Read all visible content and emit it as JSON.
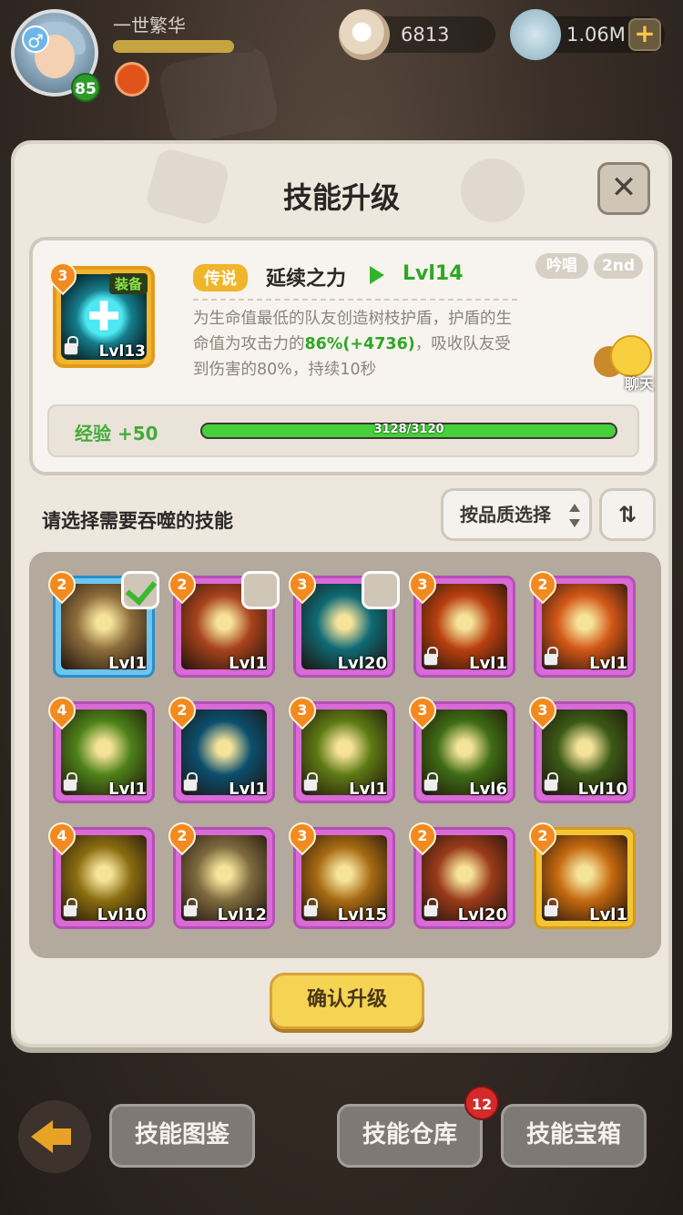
{
  "player": {
    "name": "一世繁华",
    "level": "85",
    "exp_fraction": 0.85
  },
  "currency": {
    "pearls": "6813",
    "shells": "1.06M"
  },
  "panel": {
    "title": "技能升级",
    "skill": {
      "rarity": "传说",
      "name": "延续之力",
      "level": "Lvl14",
      "icon_level": "Lvl13",
      "equip": "装备",
      "star": "3",
      "tag1": "吟唱",
      "tag2": "2nd",
      "desc_pre": "为生命值最低的队友创造树枝护盾，护盾的生命值为攻击力的",
      "desc_pct": "86%",
      "desc_bonus": "(+4736)",
      "desc_post": "，吸收队友受到伤害的80%，持续10秒"
    },
    "exp": {
      "label": "经验 +50",
      "progress": "3128/3120",
      "fill_fraction": 1.0
    },
    "chat_label": "聊天",
    "choose_label": "请选择需要吞噬的技能",
    "filter_label": "按品质选择",
    "confirm_label": "确认升级"
  },
  "grid": [
    {
      "star": "2",
      "level": "Lvl1",
      "quality": "blue",
      "check": "on",
      "lock": false,
      "art": "owl-art",
      "color": "#8d6d3c"
    },
    {
      "star": "2",
      "level": "Lvl1",
      "quality": "purple",
      "check": "off",
      "lock": false,
      "art": "spiral-art",
      "color": "#a8431d"
    },
    {
      "star": "3",
      "level": "Lvl20",
      "quality": "purple",
      "check": "off",
      "lock": false,
      "art": "heal-art",
      "color": "#0e6a74"
    },
    {
      "star": "3",
      "level": "Lvl1",
      "quality": "purple",
      "check": "",
      "lock": true,
      "art": "flame-art",
      "color": "#b9400f"
    },
    {
      "star": "2",
      "level": "Lvl1",
      "quality": "purple",
      "check": "",
      "lock": true,
      "art": "cross-art",
      "color": "#d35717"
    },
    {
      "star": "4",
      "level": "Lvl1",
      "quality": "purple",
      "check": "",
      "lock": true,
      "art": "robot-art",
      "color": "#4d8218"
    },
    {
      "star": "2",
      "level": "Lvl1",
      "quality": "purple",
      "check": "",
      "lock": true,
      "art": "moon-art",
      "color": "#0b4f6e"
    },
    {
      "star": "3",
      "level": "Lvl1",
      "quality": "purple",
      "check": "",
      "lock": true,
      "art": "seed-art",
      "color": "#5e7a14"
    },
    {
      "star": "3",
      "level": "Lvl6",
      "quality": "purple",
      "check": "",
      "lock": true,
      "art": "green-heal-art",
      "color": "#3e6c14"
    },
    {
      "star": "3",
      "level": "Lvl10",
      "quality": "purple",
      "check": "",
      "lock": true,
      "art": "heart-art",
      "color": "#3b5a16"
    },
    {
      "star": "4",
      "level": "Lvl10",
      "quality": "purple",
      "check": "",
      "lock": true,
      "art": "shadow-art",
      "color": "#8a6d10"
    },
    {
      "star": "2",
      "level": "Lvl12",
      "quality": "purple",
      "check": "",
      "lock": true,
      "art": "owl-art",
      "color": "#7d6a3e"
    },
    {
      "star": "3",
      "level": "Lvl15",
      "quality": "purple",
      "check": "",
      "lock": true,
      "art": "sprout-art",
      "color": "#a66a12"
    },
    {
      "star": "2",
      "level": "Lvl20",
      "quality": "purple",
      "check": "",
      "lock": true,
      "art": "spiral-art",
      "color": "#9a3b1a"
    },
    {
      "star": "2",
      "level": "Lvl1",
      "quality": "gold",
      "check": "",
      "lock": true,
      "art": "hawk-art",
      "color": "#c4690f"
    }
  ],
  "bottom": {
    "btn1": "技能图鉴",
    "btn2": "技能仓库",
    "btn2_badge": "12",
    "btn3": "技能宝箱"
  }
}
